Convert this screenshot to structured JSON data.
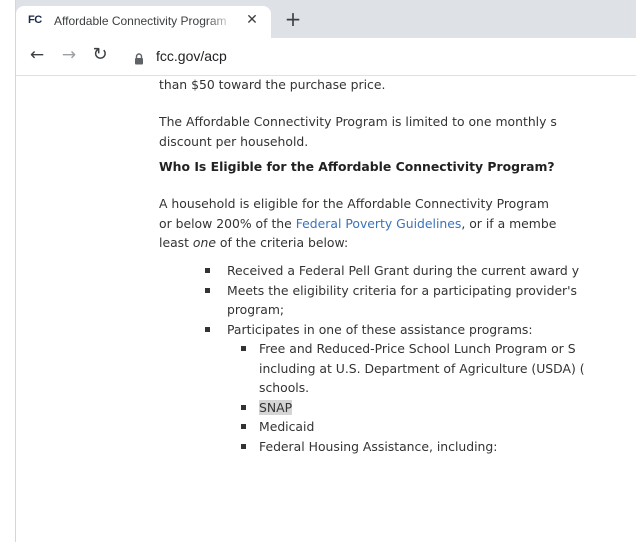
{
  "browser": {
    "tab": {
      "favicon_text": "FC",
      "title": "Affordable Connectivity Program",
      "close_glyph": "✕"
    },
    "new_tab_glyph": "+",
    "nav": {
      "back_glyph": "←",
      "forward_glyph": "→",
      "reload_glyph": "↻"
    },
    "address": {
      "icon": "lock-icon",
      "url": "fcc.gov/acp"
    }
  },
  "page": {
    "para_top": "than $50 toward the purchase price.",
    "para_limit": [
      "The Affordable Connectivity Program is limited to one monthly s",
      "discount per household."
    ],
    "heading": "Who Is Eligible for the Affordable Connectivity Program?",
    "eligibility": {
      "line1": "A household is eligible for the Affordable Connectivity Program",
      "line2_before": "or below 200% of the ",
      "line2_link": "Federal Poverty Guidelines",
      "line2_after": ", or if a membe",
      "line3_before": "least ",
      "line3_em": "one",
      "line3_after": " of the criteria below:"
    },
    "criteria": {
      "pell": "Received a Federal Pell Grant during the current award y",
      "provider": [
        "Meets the eligibility criteria for a participating provider's",
        "program;"
      ],
      "assistance": "Participates in one of these assistance programs:",
      "programs": {
        "lunch": [
          "Free and Reduced-Price School Lunch Program or S",
          "including at U.S. Department of Agriculture (USDA) (",
          "schools."
        ],
        "snap": "SNAP",
        "medicaid": "Medicaid",
        "housing": "Federal Housing Assistance, including:"
      }
    }
  },
  "colors": {
    "link": "#3b73b9",
    "tabstrip": "#dee1e6",
    "selection": "#d5d5d5"
  }
}
